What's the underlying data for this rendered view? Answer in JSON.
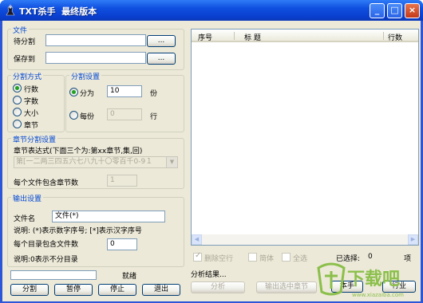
{
  "window": {
    "title": "TXT杀手  最终版本",
    "minimize": "_",
    "maximize": "□",
    "close": "×"
  },
  "file": {
    "legend": "文件",
    "source_label": "待分割",
    "source_value": "",
    "save_label": "保存到",
    "save_value": "",
    "browse": "...",
    "browse2": "..."
  },
  "split_mode": {
    "legend": "分割方式",
    "options": [
      "行数",
      "字数",
      "大小",
      "章节"
    ],
    "selected": "行数"
  },
  "split_settings": {
    "legend": "分割设置",
    "divide_label": "分为",
    "divide_value": "10",
    "divide_unit": "份",
    "each_label": "每份",
    "each_value": "0",
    "each_unit": "行"
  },
  "chapter": {
    "legend": "章节分割设置",
    "expr_label": "章节表达式(下面三个为:第xx章节,集,回)",
    "expr_value": "第[一二两三四五六七八九十〇零百千0-9１",
    "files_per_chapter_label": "每个文件包含章节数",
    "files_per_chapter_value": "1"
  },
  "output": {
    "legend": "输出设置",
    "filename_label": "文件名",
    "filename_value": "文件(*)",
    "note1": "说明: (*)表示数字序号; [*]表示汉字序号",
    "per_dir_label": "每个目录包含文件数",
    "per_dir_value": "0",
    "note2": "说明:0表示不分目录"
  },
  "status": {
    "text": "就绪"
  },
  "buttons": {
    "split": "分割",
    "pause": "暂停",
    "stop": "停止",
    "exit": "退出"
  },
  "list": {
    "columns": [
      "序号",
      "标    题",
      "行数"
    ],
    "remove_blank": "删除空行",
    "simplified": "简体",
    "select_all": "全选",
    "selected_label": "已选择:",
    "selected_value": "0",
    "item_label": "项",
    "analysis_label": "分析结果...",
    "analyze_button": "分析",
    "export_button": "输出选中章节",
    "manual": "本手",
    "row_count": "行业"
  },
  "watermark": {
    "text": "下载吧",
    "url": "www.xiazaiba.com"
  }
}
